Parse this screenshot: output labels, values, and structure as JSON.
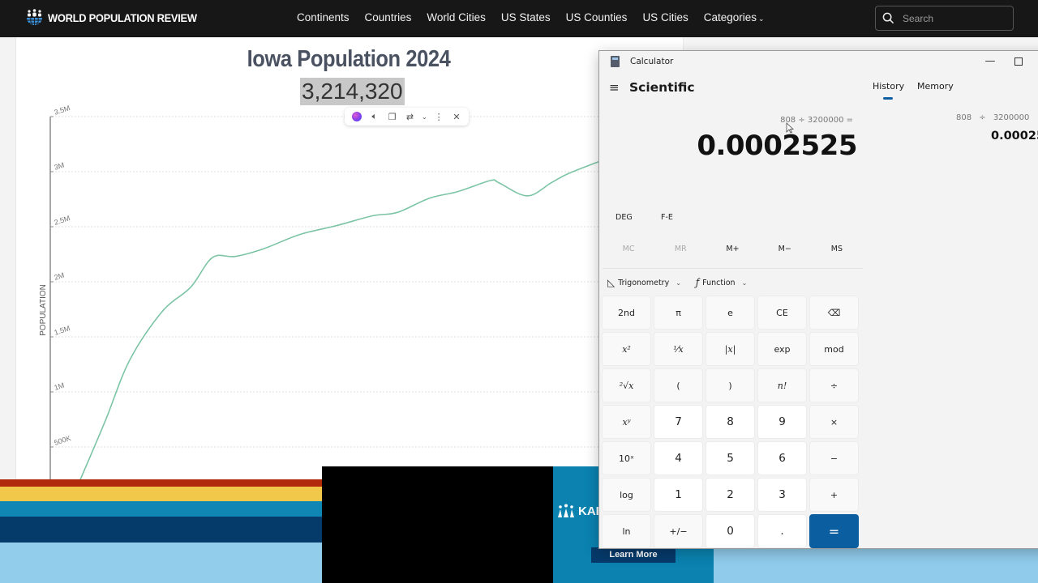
{
  "site": {
    "brand": "WORLD POPULATION REVIEW",
    "nav": [
      {
        "label": "Continents"
      },
      {
        "label": "Countries"
      },
      {
        "label": "World Cities"
      },
      {
        "label": "US States"
      },
      {
        "label": "US Counties"
      },
      {
        "label": "US Cities"
      },
      {
        "label": "Categories"
      }
    ],
    "search_placeholder": "Search"
  },
  "page": {
    "title": "Iowa Population 2024",
    "highlighted_value": "3,214,320"
  },
  "selection_toolbar": {
    "icons": [
      "copilot-icon",
      "read-aloud-icon",
      "copy-icon",
      "translate-icon",
      "more-icon",
      "close-icon"
    ]
  },
  "chart_data": {
    "type": "line",
    "title": "Iowa Population 2024",
    "ylabel": "POPULATION",
    "xlabel": "",
    "ylim": [
      0,
      3500000
    ],
    "yticks": [
      {
        "value": 500000,
        "label": "500K"
      },
      {
        "value": 1000000,
        "label": "1M"
      },
      {
        "value": 1500000,
        "label": "1.5M"
      },
      {
        "value": 2000000,
        "label": "2M"
      },
      {
        "value": 2500000,
        "label": "2.5M"
      },
      {
        "value": 3000000,
        "label": "3M"
      },
      {
        "value": 3500000,
        "label": "3.5M"
      }
    ],
    "grid": true,
    "line_color": "#7cc4a5",
    "series": [
      {
        "name": "Population",
        "values": [
          220000,
          740000,
          1290000,
          1730000,
          1950000,
          2220000,
          2230000,
          2300000,
          2430000,
          2510000,
          2600000,
          2630000,
          2760000,
          2820000,
          2920000,
          2900000,
          2780000,
          2900000,
          2980000,
          3090000
        ]
      }
    ]
  },
  "ads": {
    "kp_brand": "KAI",
    "learn_more": "Learn More",
    "stripe_colors": [
      "#b22a0c",
      "#f2c84b",
      "#0f86b4",
      "#053b6a",
      "#92cdec"
    ]
  },
  "calculator": {
    "window_title": "Calculator",
    "mode": "Scientific",
    "tabs": {
      "history": "History",
      "memory": "Memory"
    },
    "expression": "808 ÷ 3200000 =",
    "result": "0.0002525",
    "history_item": {
      "expression": "808 ÷ 3200000",
      "result": "0.00025"
    },
    "angle_mode": "DEG",
    "fe_label": "F-E",
    "memory_buttons": [
      {
        "label": "MC",
        "enabled": false
      },
      {
        "label": "MR",
        "enabled": false
      },
      {
        "label": "M+",
        "enabled": true
      },
      {
        "label": "M−",
        "enabled": true
      },
      {
        "label": "MS",
        "enabled": true
      }
    ],
    "trig_label": "Trigonometry",
    "function_label": "Function",
    "keys": [
      {
        "label": "2nd",
        "kind": "fn"
      },
      {
        "label": "π",
        "kind": "fn"
      },
      {
        "label": "e",
        "kind": "fn"
      },
      {
        "label": "CE",
        "kind": "fn"
      },
      {
        "label": "⌫",
        "kind": "fn"
      },
      {
        "label": "x²",
        "kind": "serif"
      },
      {
        "label": "¹⁄x",
        "kind": "serif"
      },
      {
        "label": "|x|",
        "kind": "serif"
      },
      {
        "label": "exp",
        "kind": "fn"
      },
      {
        "label": "mod",
        "kind": "fn"
      },
      {
        "label": "²√x",
        "kind": "serif"
      },
      {
        "label": "(",
        "kind": "fn"
      },
      {
        "label": ")",
        "kind": "fn"
      },
      {
        "label": "n!",
        "kind": "serif"
      },
      {
        "label": "÷",
        "kind": "fn"
      },
      {
        "label": "xʸ",
        "kind": "serif"
      },
      {
        "label": "7",
        "kind": "num"
      },
      {
        "label": "8",
        "kind": "num"
      },
      {
        "label": "9",
        "kind": "num"
      },
      {
        "label": "×",
        "kind": "fn"
      },
      {
        "label": "10ˣ",
        "kind": "fn"
      },
      {
        "label": "4",
        "kind": "num"
      },
      {
        "label": "5",
        "kind": "num"
      },
      {
        "label": "6",
        "kind": "num"
      },
      {
        "label": "−",
        "kind": "fn"
      },
      {
        "label": "log",
        "kind": "fn"
      },
      {
        "label": "1",
        "kind": "num"
      },
      {
        "label": "2",
        "kind": "num"
      },
      {
        "label": "3",
        "kind": "num"
      },
      {
        "label": "+",
        "kind": "fn"
      },
      {
        "label": "ln",
        "kind": "fn"
      },
      {
        "label": "+/−",
        "kind": "fn"
      },
      {
        "label": "0",
        "kind": "num"
      },
      {
        "label": ".",
        "kind": "num"
      },
      {
        "label": "=",
        "kind": "eq"
      }
    ],
    "accent_color": "#0b5ea0"
  }
}
